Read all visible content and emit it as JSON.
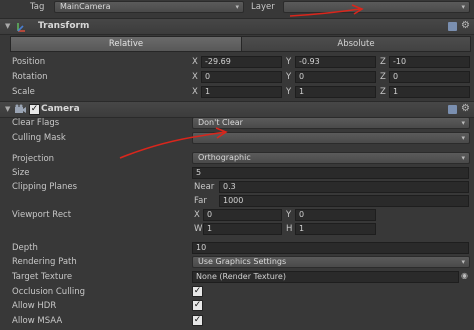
{
  "top": {
    "tag_label": "Tag",
    "tag_value": "MainCamera",
    "layer_label": "Layer",
    "layer_value": ""
  },
  "transform": {
    "title": "Transform",
    "tabs": [
      "Relative",
      "Absolute"
    ],
    "position_label": "Position",
    "rotation_label": "Rotation",
    "scale_label": "Scale",
    "axes": [
      "X",
      "Y",
      "Z"
    ],
    "position": [
      "-29.69",
      "-0.93",
      "-10"
    ],
    "rotation": [
      "0",
      "0",
      "0"
    ],
    "scale": [
      "1",
      "1",
      "1"
    ]
  },
  "camera": {
    "title": "Camera",
    "clear_flags_label": "Clear Flags",
    "clear_flags_value": "Don't Clear",
    "culling_mask_label": "Culling Mask",
    "culling_mask_value": "",
    "projection_label": "Projection",
    "projection_value": "Orthographic",
    "size_label": "Size",
    "size_value": "5",
    "clipping_label": "Clipping Planes",
    "near_label": "Near",
    "near_value": "0.3",
    "far_label": "Far",
    "far_value": "1000",
    "viewport_label": "Viewport Rect",
    "vp_x_label": "X",
    "vp_x": "0",
    "vp_y_label": "Y",
    "vp_y": "0",
    "vp_w_label": "W",
    "vp_w": "1",
    "vp_h_label": "H",
    "vp_h": "1",
    "depth_label": "Depth",
    "depth_value": "10",
    "rendering_label": "Rendering Path",
    "rendering_value": "Use Graphics Settings",
    "target_label": "Target Texture",
    "target_value": "None (Render Texture)",
    "occlusion_label": "Occlusion Culling",
    "hdr_label": "Allow HDR",
    "msaa_label": "Allow MSAA",
    "occlusion_checked": true,
    "hdr_checked": true,
    "msaa_checked": true
  },
  "colors": {
    "background": "#383838",
    "annotation": "#d9261c"
  }
}
